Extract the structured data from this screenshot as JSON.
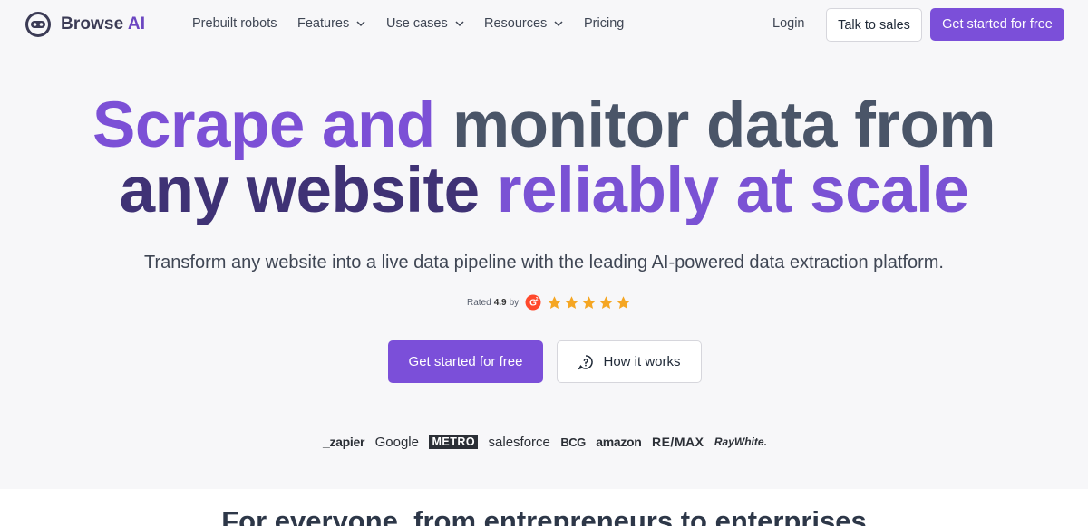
{
  "brand": {
    "name_part1": "Browse",
    "name_part2": "AI"
  },
  "nav": {
    "prebuilt": "Prebuilt robots",
    "features": "Features",
    "use_cases": "Use cases",
    "resources": "Resources",
    "pricing": "Pricing",
    "login": "Login",
    "talk_to_sales": "Talk to sales",
    "get_started": "Get started for free"
  },
  "hero": {
    "line1_a": "Scrape and",
    "line1_b": "monitor data from",
    "line2_a": "any website",
    "line2_b": "reliably at scale",
    "subtitle": "Transform any website into a live data pipeline with the leading AI-powered data extraction platform.",
    "rating_prefix": "Rated",
    "rating_value": "4.9",
    "rating_suffix": "by",
    "star_count": 5,
    "cta_primary": "Get started for free",
    "cta_secondary": "How it works"
  },
  "customers": [
    "_zapier",
    "Google",
    "METRO",
    "salesforce",
    "BCG",
    "amazon",
    "RE/MAX",
    "RayWhite."
  ],
  "section2": {
    "title": "For everyone, from entrepreneurs to enterprises"
  },
  "colors": {
    "accent": "#7b4fd9",
    "headline_purple": "#7c50d6",
    "headline_slate": "#4a5568",
    "headline_indigo": "#3f3275",
    "star": "#f5a623",
    "g2_red": "#ff492c"
  },
  "icons": [
    "browse-ai-logo-icon",
    "chevron-down-icon",
    "g2-icon",
    "star-icon",
    "chat-bubble-icon"
  ]
}
